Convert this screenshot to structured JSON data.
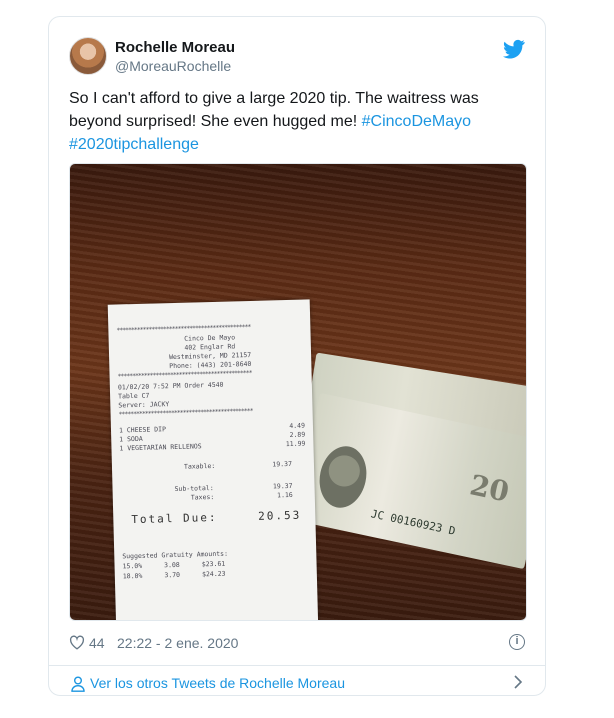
{
  "tweet": {
    "user": {
      "name": "Rochelle Moreau",
      "handle": "@MoreauRochelle"
    },
    "text_plain": "So I can't afford to give a large 2020 tip. The waitress was beyond surprised! She even hugged me! ",
    "hashtags": [
      "#CincoDeMayo",
      "#2020tipchallenge"
    ],
    "likes": "44",
    "timestamp": "22:22 - 2 ene. 2020",
    "footer_link": "Ver los otros Tweets de Rochelle Moreau"
  },
  "receipt": {
    "restaurant": "Cinco De Mayo",
    "address1": "402 Englar Rd",
    "address2": "Westminster, MD 21157",
    "phone": "Phone: (443) 201-8640",
    "date_line": "01/02/20    7:52 PM Order 4540",
    "table": "Table C7",
    "server": "Server: JACKY",
    "items": [
      {
        "name": "1 CHEESE DIP",
        "price": "4.49"
      },
      {
        "name": "1 SODA",
        "price": "2.89"
      },
      {
        "name": "1 VEGETARIAN RELLENOS",
        "price": "11.99"
      }
    ],
    "taxable_label": "Taxable:",
    "taxable": "19.37",
    "subtotal_label": "Sub-total:",
    "subtotal": "19.37",
    "taxes_label": "Taxes:",
    "taxes": "1.16",
    "total_label": "Total Due:",
    "total": "20.53",
    "gratuity_title": "Suggested Gratuity Amounts:",
    "gratuity": [
      {
        "pct": "15.0%",
        "tip": "3.08",
        "total": "$23.61"
      },
      {
        "pct": "18.0%",
        "tip": "3.70",
        "total": "$24.23"
      }
    ]
  },
  "bill": {
    "serial": "JC 00160923 D",
    "denomination": "20"
  },
  "colors": {
    "link": "#1b95e0",
    "muted": "#657786",
    "border": "#e1e8ed"
  }
}
